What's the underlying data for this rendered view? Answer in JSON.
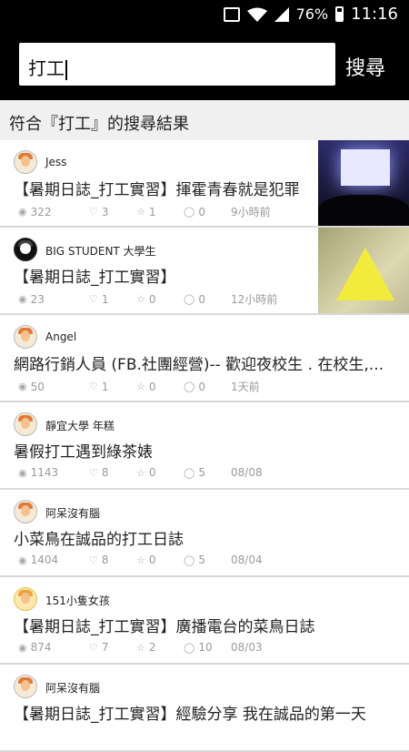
{
  "status_bar": {
    "battery": "76%",
    "time": "11:16"
  },
  "search": {
    "query": "打工",
    "button_label": "搜尋"
  },
  "result_header": "符合『打工』的搜尋結果",
  "items": [
    {
      "author": "Jess",
      "title": "【暑期日誌_打工實習】揮霍青春就是犯罪",
      "views": "322",
      "likes": "3",
      "stars": "1",
      "comments": "0",
      "time": "9小時前",
      "thumb": "theater"
    },
    {
      "author": "BIG STUDENT 大學生",
      "title": "【暑期日誌_打工實習】",
      "views": "23",
      "likes": "1",
      "stars": "0",
      "comments": "0",
      "time": "12小時前",
      "thumb": "triangle"
    },
    {
      "author": "Angel",
      "title": "網路行銷人員 (FB.社團經營)-- 歡迎夜校生 . 在校生,...",
      "views": "50",
      "likes": "1",
      "stars": "0",
      "comments": "0",
      "time": "1天前"
    },
    {
      "author": "靜宜大學 年糕",
      "title": "暑假打工遇到綠茶婊",
      "views": "1143",
      "likes": "8",
      "stars": "0",
      "comments": "5",
      "time": "08/08"
    },
    {
      "author": "阿呆沒有腦",
      "title": "小菜鳥在誠品的打工日誌",
      "views": "1404",
      "likes": "8",
      "stars": "0",
      "comments": "5",
      "time": "08/04"
    },
    {
      "author": "151小隻女孩",
      "title": "【暑期日誌_打工實習】廣播電台的菜鳥日誌",
      "views": "874",
      "likes": "7",
      "stars": "2",
      "comments": "10",
      "time": "08/03"
    },
    {
      "author": "阿呆沒有腦",
      "title": "【暑期日誌_打工實習】經驗分享 我在誠品的第一天",
      "views": "",
      "likes": "",
      "stars": "",
      "comments": "",
      "time": ""
    }
  ],
  "icons": {
    "view": "eye-icon",
    "like": "heart-icon",
    "star": "star-icon",
    "comment": "comment-icon"
  }
}
